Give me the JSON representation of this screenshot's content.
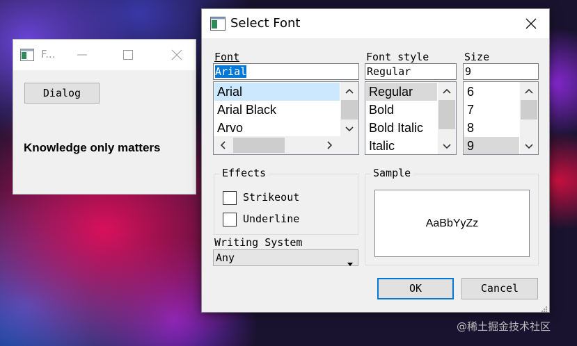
{
  "background_window": {
    "title": "F...",
    "dialog_button": "Dialog",
    "text": "Knowledge only matters"
  },
  "font_dialog": {
    "title": "Select Font",
    "font": {
      "label": "Font",
      "value": "Arial",
      "options": [
        "Arial",
        "Arial Black",
        "Arvo"
      ]
    },
    "style": {
      "label": "Font style",
      "value": "Regular",
      "options": [
        "Regular",
        "Bold",
        "Bold Italic",
        "Italic"
      ]
    },
    "size": {
      "label": "Size",
      "value": "9",
      "options": [
        "6",
        "7",
        "8",
        "9"
      ]
    },
    "effects": {
      "title": "Effects",
      "strikeout": "Strikeout",
      "underline": "Underline"
    },
    "sample": {
      "title": "Sample",
      "text": "AaBbYyZz"
    },
    "writing_system": {
      "label": "Writing System",
      "value": "Any"
    },
    "ok": "OK",
    "cancel": "Cancel"
  },
  "colors": {
    "accent": "#0078d7",
    "selection_gray": "#cce8ff",
    "list_selected_inactive": "#d9d9d9"
  },
  "watermark": "@稀土掘金技术社区"
}
